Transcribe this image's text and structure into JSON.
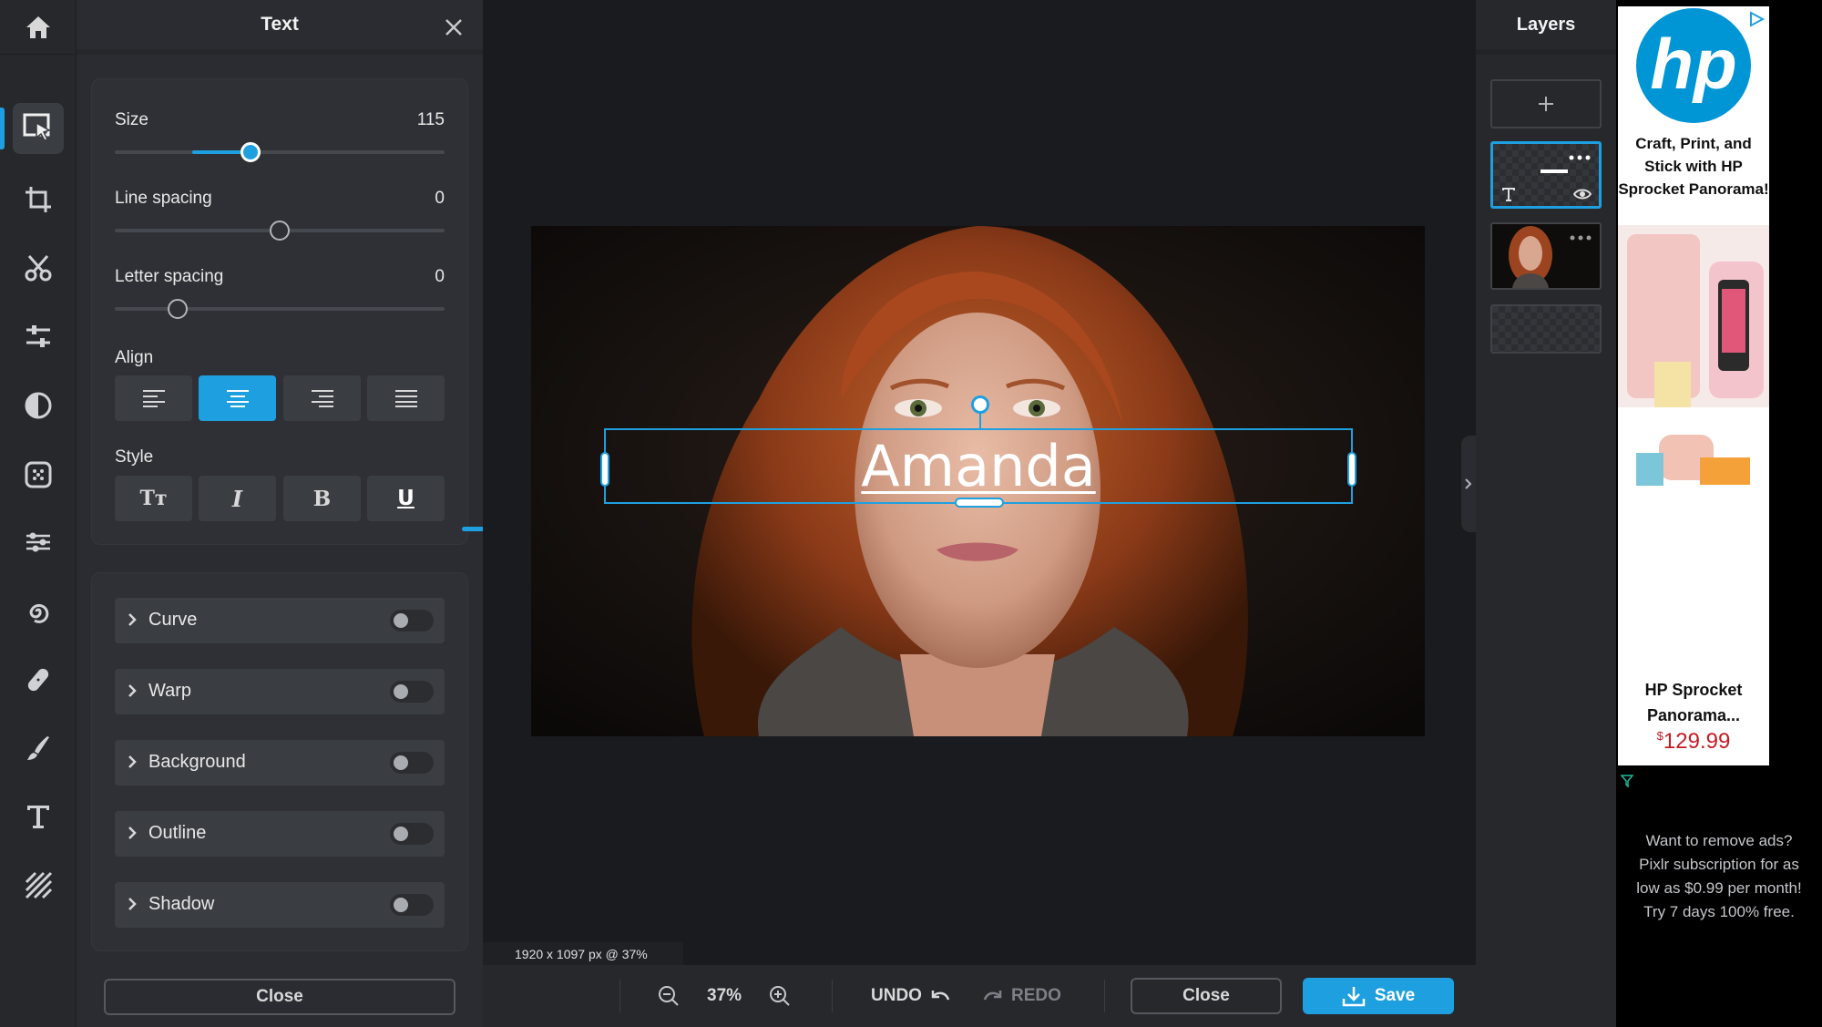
{
  "panel": {
    "title": "Text",
    "close_label": "Close",
    "sliders": [
      {
        "label": "Size",
        "value": "115",
        "fraction": 0.41
      },
      {
        "label": "Line spacing",
        "value": "0",
        "fraction": 0.5
      },
      {
        "label": "Letter spacing",
        "value": "0",
        "fraction": 0.19
      }
    ],
    "align": {
      "label": "Align",
      "options": [
        "left",
        "center",
        "right",
        "justify"
      ],
      "selected": "center"
    },
    "style": {
      "label": "Style",
      "options": [
        "text-case",
        "italic",
        "bold",
        "underline"
      ],
      "active": "underline",
      "glyphs": [
        "Tт",
        "I",
        "B",
        "U"
      ]
    },
    "effects": [
      {
        "label": "Curve",
        "enabled": false
      },
      {
        "label": "Warp",
        "enabled": false
      },
      {
        "label": "Background",
        "enabled": false
      },
      {
        "label": "Outline",
        "enabled": false
      },
      {
        "label": "Shadow",
        "enabled": false
      }
    ]
  },
  "canvas": {
    "text": "Amanda",
    "dimensions": "1920 x 1097 px @ 37%"
  },
  "bottombar": {
    "zoom": "37%",
    "undo": "UNDO",
    "redo": "REDO",
    "close": "Close",
    "save": "Save"
  },
  "layers": {
    "title": "Layers",
    "add_icon": "plus-icon",
    "items": [
      "text-layer",
      "photo-layer",
      "empty-layer"
    ]
  },
  "ad": {
    "headline": "Craft, Print, and Stick with HP Sprocket Panorama!",
    "product": "HP Sprocket Panorama...",
    "price_symbol": "$",
    "price": "129.99",
    "remove_ads": "Want to remove ads? Pixlr subscription for as low as $0.99 per month!",
    "trial": "Try 7 days 100% free."
  },
  "colors": {
    "accent": "#1ea0e0",
    "panel": "#2a2c31",
    "background": "#1a1b1e",
    "price": "#c41c24"
  }
}
